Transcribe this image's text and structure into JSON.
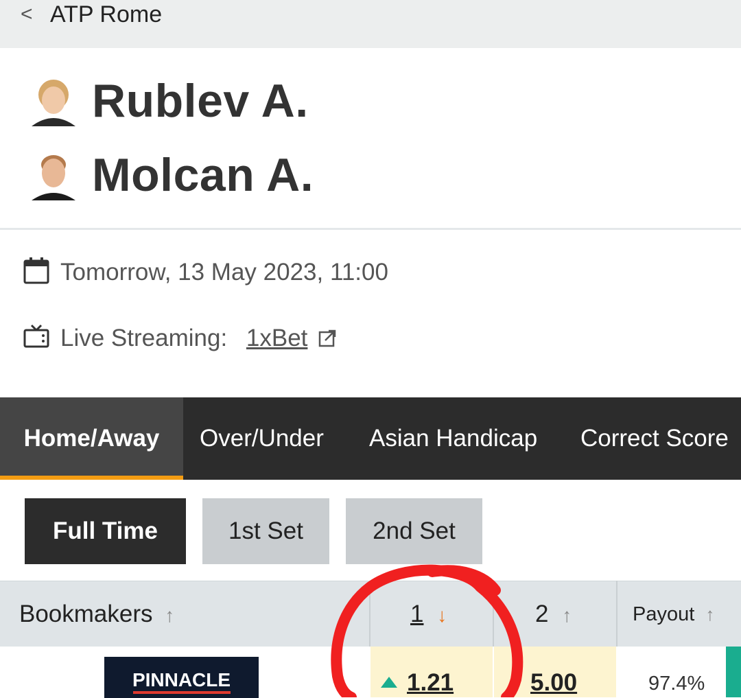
{
  "header": {
    "back_label": "<",
    "competition": "ATP Rome"
  },
  "players": [
    {
      "name": "Rublev A."
    },
    {
      "name": "Molcan A."
    }
  ],
  "info": {
    "date": "Tomorrow, 13 May 2023, 11:00",
    "streaming_label": "Live Streaming:",
    "streaming_link": "1xBet"
  },
  "market_tabs": [
    "Home/Away",
    "Over/Under",
    "Asian Handicap",
    "Correct Score"
  ],
  "period_tabs": [
    "Full Time",
    "1st Set",
    "2nd Set"
  ],
  "table": {
    "headers": {
      "bookmakers": "Bookmakers",
      "home": "1",
      "away": "2",
      "payout": "Payout"
    },
    "rows": [
      {
        "bookmaker_logo_text": "PINNACLE",
        "home": "1.21",
        "away": "5.00",
        "payout": "97.4%"
      }
    ]
  },
  "colors": {
    "tab_accent": "#f39c12",
    "odds_up": "#1aad8f",
    "odds_down": "#e8731a",
    "annotation": "#f02020"
  }
}
